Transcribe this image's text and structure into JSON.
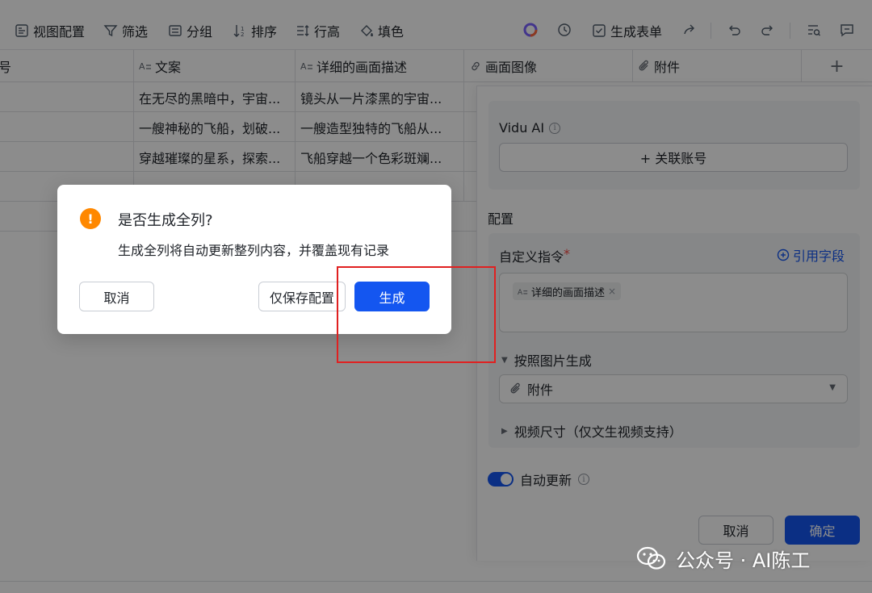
{
  "toolbar": {
    "view_config": "视图配置",
    "filter": "筛选",
    "group": "分组",
    "sort": "排序",
    "row_height": "行高",
    "fill_color": "填色",
    "generate_form": "生成表单"
  },
  "table": {
    "headers": {
      "first_partial": "号",
      "copy": "文案",
      "detail_desc": "详细的画面描述",
      "image": "画面图像",
      "attachment": "附件",
      "add": "+"
    },
    "rows": [
      {
        "copy": "在无尽的黑暗中，宇宙...",
        "detail": "镜头从一片漆黑的宇宙..."
      },
      {
        "copy": "一艘神秘的飞船，划破...",
        "detail": "一艘造型独特的飞船从..."
      },
      {
        "copy": "穿越璀璨的星系，探索...",
        "detail": "飞船穿越一个色彩斑斓..."
      },
      {
        "copy": "",
        "detail": ""
      }
    ]
  },
  "panel": {
    "vidu_label": "Vidu AI",
    "link_account": "+ 关联账号",
    "config_title": "配置",
    "custom_instruction": "自定义指令",
    "required_mark": "*",
    "reference_field": "引用字段",
    "field_tag": "详细的画面描述",
    "generate_by_image": "按照图片生成",
    "attachment_select": "附件",
    "video_size": "视频尺寸（仅文生视频支持）",
    "auto_update": "自动更新",
    "auto_update_on": true,
    "cancel": "取消",
    "confirm": "确定"
  },
  "dialog": {
    "title": "是否生成全列?",
    "description": "生成全列将自动更新整列内容，并覆盖现有记录",
    "cancel": "取消",
    "save_config_only": "仅保存配置",
    "generate": "生成",
    "warning_symbol": "!"
  },
  "watermark": {
    "text": "公众号 · AI陈工"
  },
  "colors": {
    "primary": "#1456f0",
    "warning": "#ff8800",
    "highlight_box": "#e02020"
  }
}
